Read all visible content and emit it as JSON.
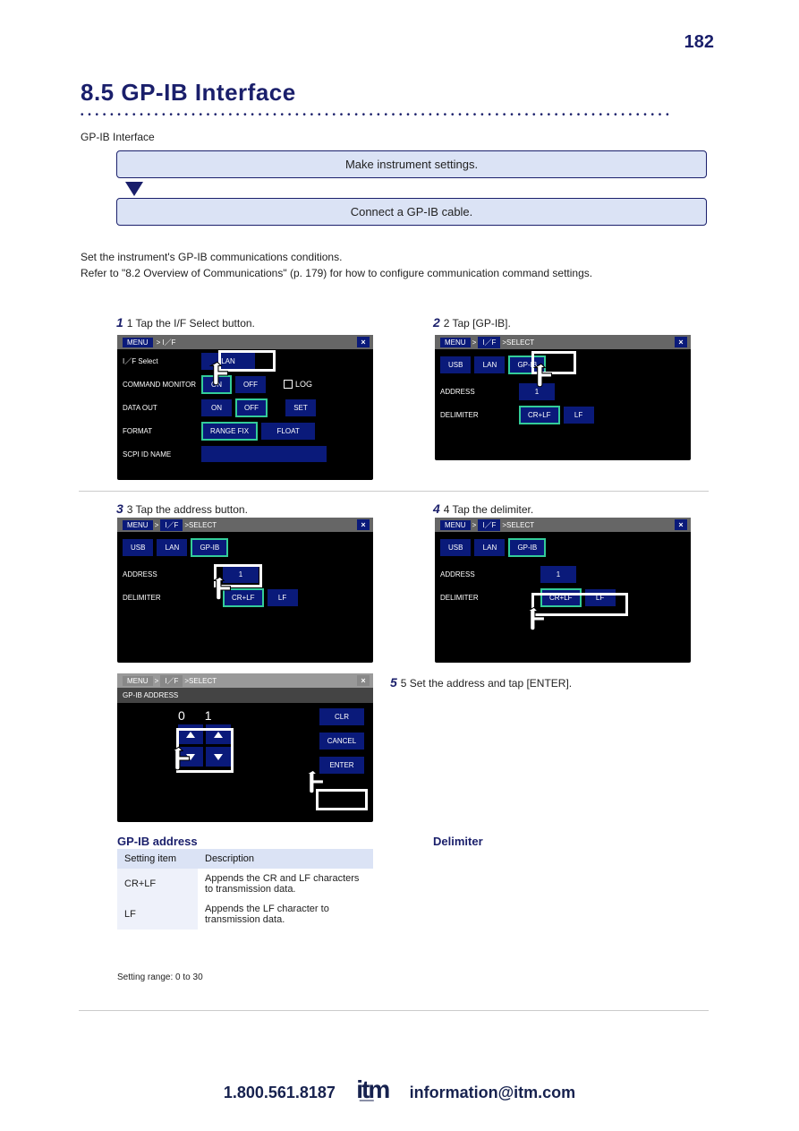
{
  "page_number": "182",
  "section_title": "8.5  GP-IB Interface",
  "header_text": "GP-IB Interface",
  "flow": {
    "step1": "Make instrument settings.",
    "step2": "Connect a GP-IB cable."
  },
  "desc1": "Set the instrument's GP-IB communications conditions.",
  "desc2": "Refer to \"8.2 Overview of Communications\" (p. 179) for how to configure communication command settings.",
  "step_caption_1": "1 Tap the I/F Select button.",
  "step_caption_2": "2 Tap [GP-IB].",
  "step_caption_3": "3 Tap the address button.",
  "step_caption_4": "4 Tap the delimiter.",
  "step_caption_5": "5 Set the address and tap [ENTER].",
  "ui": {
    "menu": "MENU",
    "crumb_if": "I／F",
    "crumb_select": "SELECT",
    "close": "×",
    "if_select": "I／F Select",
    "cmd_monitor": "COMMAND MONITOR",
    "data_out": "DATA OUT",
    "format": "FORMAT",
    "scpi": "SCPI ID NAME",
    "lan": "LAN",
    "usb": "USB",
    "gpib": "GP-IB",
    "on": "ON",
    "off": "OFF",
    "log": "LOG",
    "set": "SET",
    "range_fix": "RANGE FIX",
    "float": "FLOAT",
    "address": "ADDRESS",
    "delimiter": "DELIMITER",
    "crlf": "CR+LF",
    "lf": "LF",
    "addr_val": "1",
    "gpib_addr_title": "GP-IB ADDRESS",
    "num0": "0",
    "num1": "1",
    "clr": "CLR",
    "cancel": "CANCEL",
    "enter": "ENTER"
  },
  "delim_heading": "Delimiter",
  "delim_table": {
    "hdr_item": "Setting item",
    "hdr_desc": "Description",
    "item1": "CR+LF",
    "desc1_1": "Appends the CR and LF characters",
    "desc1_2": "to transmission data.",
    "item2": "LF",
    "desc2_1": "Appends the LF character to",
    "desc2_2": "transmission data."
  },
  "gpib_heading": "GP-IB address",
  "gpib_range": "Setting range: 0 to 30",
  "footer": {
    "left": "1.800.561.8187",
    "right": "information@itm.com"
  }
}
